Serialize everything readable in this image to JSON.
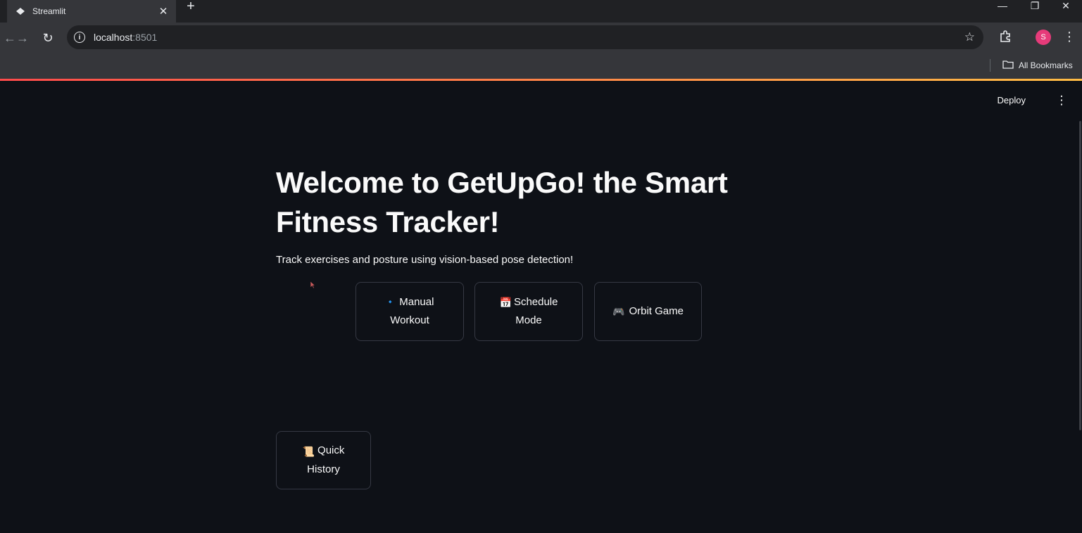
{
  "browser": {
    "tab_title": "Streamlit",
    "tab_close": "✕",
    "new_tab": "+",
    "url_host": "localhost",
    "url_port": ":8501",
    "bookmarks_label": "All Bookmarks",
    "profile_initial": "S",
    "window_controls": {
      "minimize": "—",
      "restore": "❐",
      "close": "✕"
    }
  },
  "app": {
    "deploy_label": "Deploy",
    "menu_label": "⋮",
    "title": "Welcome to GetUpGo! the Smart Fitness Tracker!",
    "subtitle": "Track exercises and posture using vision-based pose detection!",
    "buttons": [
      {
        "emoji": "🔹",
        "label_line1": "Manual",
        "label_line2": "Workout"
      },
      {
        "emoji": "📅",
        "label_line1": "Schedule",
        "label_line2": "Mode"
      },
      {
        "emoji": "🎮",
        "label": "Orbit Game"
      },
      {
        "emoji": "📜",
        "label_line1": "Quick",
        "label_line2": "History"
      }
    ]
  },
  "colors": {
    "background": "#0e1117",
    "button_border": "#363944",
    "text": "#fafafa",
    "decoration_gradient_start": "#ff4b4b",
    "decoration_gradient_end": "#ffbd45"
  }
}
